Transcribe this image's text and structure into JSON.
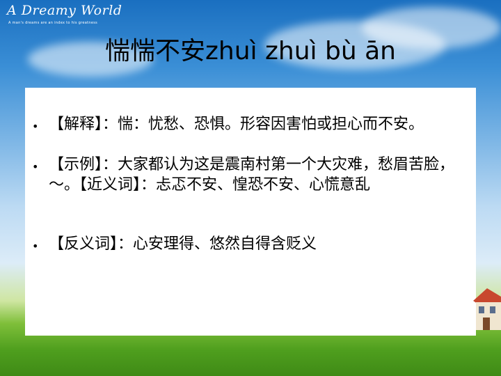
{
  "brand": {
    "name": "A Dreamy World",
    "tagline": "A man's dreams are an index to his greatness"
  },
  "title": "惴惴不安zhuì zhuì bù ān",
  "items": [
    {
      "bullet": "•",
      "text": "【解释】：惴：忧愁、恐惧。形容因害怕或担心而不安。"
    },
    {
      "bullet": "•",
      "text": "【示例】：大家都认为这是震南村第一个大灾难，愁眉苦脸，～。【近义词】：忐忑不安、惶恐不安、心慌意乱"
    },
    {
      "bullet": "•",
      "text": "【反义词】：心安理得、悠然自得含贬义"
    }
  ]
}
